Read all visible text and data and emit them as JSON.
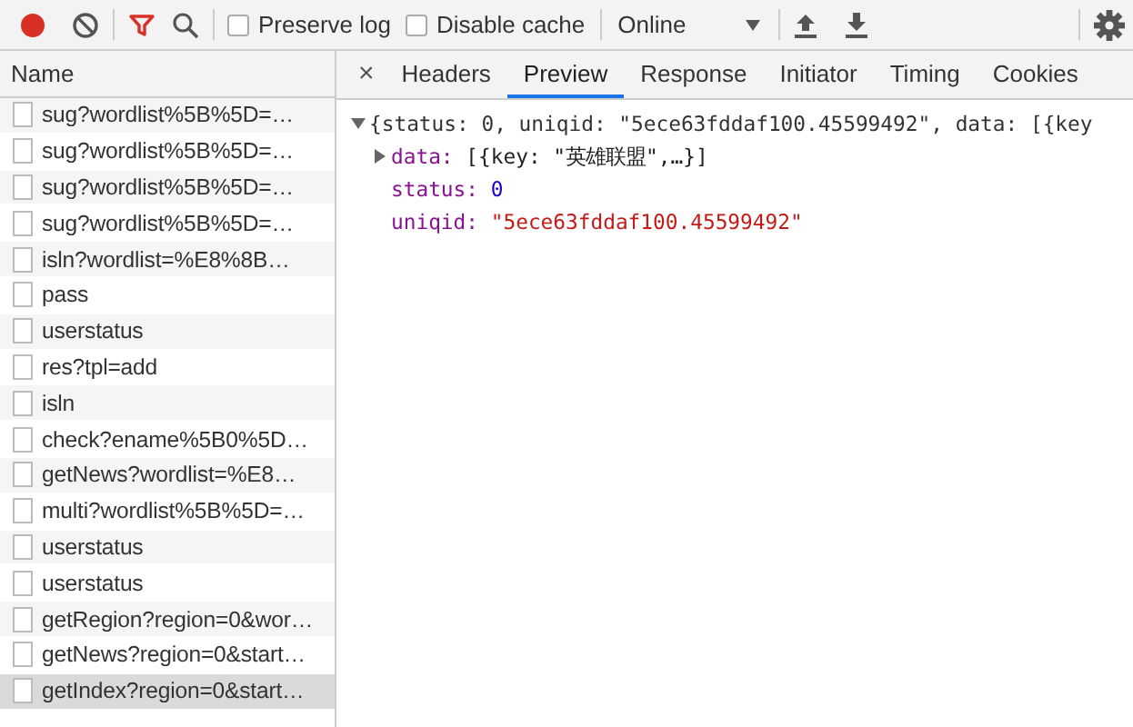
{
  "toolbar": {
    "recording": true,
    "filter_active": true,
    "checkboxes": [
      {
        "label": "Preserve log",
        "checked": false
      },
      {
        "label": "Disable cache",
        "checked": false
      }
    ],
    "throttle": "Online"
  },
  "requests": {
    "column": "Name",
    "rows": [
      {
        "name": "sug?wordlist%5B%5D=…",
        "selected": false
      },
      {
        "name": "sug?wordlist%5B%5D=…",
        "selected": false
      },
      {
        "name": "sug?wordlist%5B%5D=…",
        "selected": false
      },
      {
        "name": "sug?wordlist%5B%5D=…",
        "selected": false
      },
      {
        "name": "isln?wordlist=%E8%8B…",
        "selected": false
      },
      {
        "name": "pass",
        "selected": false
      },
      {
        "name": "userstatus",
        "selected": false
      },
      {
        "name": "res?tpl=add",
        "selected": false
      },
      {
        "name": "isln",
        "selected": false
      },
      {
        "name": "check?ename%5B0%5D…",
        "selected": false
      },
      {
        "name": "getNews?wordlist=%E8…",
        "selected": false
      },
      {
        "name": "multi?wordlist%5B%5D=…",
        "selected": false
      },
      {
        "name": "userstatus",
        "selected": false
      },
      {
        "name": "userstatus",
        "selected": false
      },
      {
        "name": "getRegion?region=0&wor…",
        "selected": false
      },
      {
        "name": "getNews?region=0&start…",
        "selected": false
      },
      {
        "name": "getIndex?region=0&start…",
        "selected": true
      }
    ]
  },
  "detail": {
    "close": "×",
    "tabs": [
      {
        "label": "Headers",
        "selected": false
      },
      {
        "label": "Preview",
        "selected": true
      },
      {
        "label": "Response",
        "selected": false
      },
      {
        "label": "Initiator",
        "selected": false
      },
      {
        "label": "Timing",
        "selected": false
      },
      {
        "label": "Cookies",
        "selected": false
      }
    ],
    "preview": {
      "summary": "{status: 0, uniqid: \"5ece63fddaf100.45599492\", data: [{key",
      "expanded": true,
      "properties": [
        {
          "key": "data:",
          "value": "[{key: \"英雄联盟\",…}]",
          "kind": "array",
          "expanded": false
        },
        {
          "key": "status:",
          "value": "0",
          "kind": "number"
        },
        {
          "key": "uniqid:",
          "value": "\"5ece63fddaf100.45599492\"",
          "kind": "string"
        }
      ]
    }
  }
}
